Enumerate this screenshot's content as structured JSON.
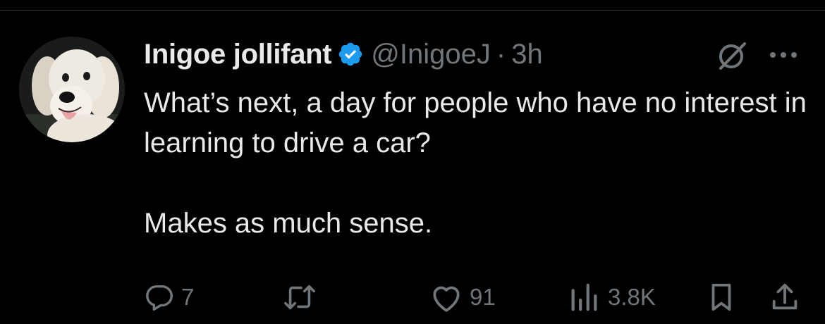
{
  "tweet": {
    "display_name": "Inigoe jollifant",
    "handle": "@InigoeJ",
    "separator": "·",
    "time": "3h",
    "text": "What’s next, a day for people who have no interest in learning to drive a car?\n\nMakes as much sense.",
    "verified": true
  },
  "actions": {
    "replies": "7",
    "reposts": "",
    "likes": "91",
    "views": "3.8K"
  },
  "icons": {
    "avatar": "golden-retriever-avatar",
    "verified": "verified-badge-icon",
    "grok": "grok-icon",
    "more": "more-icon",
    "reply": "reply-icon",
    "repost": "repost-icon",
    "like": "heart-icon",
    "views": "views-icon",
    "bookmark": "bookmark-icon",
    "share": "share-icon"
  },
  "colors": {
    "background": "#000000",
    "text": "#e7e9ea",
    "secondary": "#71767b",
    "verified": "#1d9bf0"
  }
}
